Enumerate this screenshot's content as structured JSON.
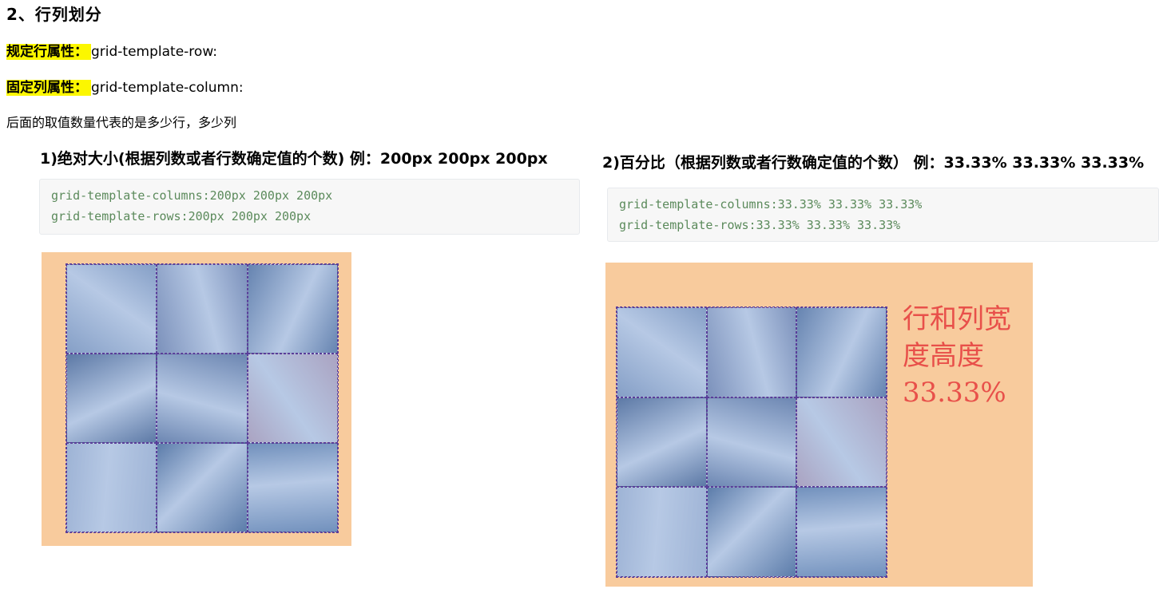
{
  "heading": "2、行列划分",
  "row_prop": {
    "label": "规定行属性：",
    "value": "grid-template-row:"
  },
  "col_prop": {
    "label": "固定列属性：",
    "value": "grid-template-column:"
  },
  "description": "后面的取值数量代表的是多少行，多少列",
  "example1": {
    "title": "1)绝对大小(根据列数或者行数确定值的个数) 例：200px 200px 200px",
    "code_line1": "grid-template-columns:200px 200px 200px",
    "code_line2": "grid-template-rows:200px 200px 200px"
  },
  "example2": {
    "title": "2)百分比（根据列数或者行数确定值的个数） 例：33.33% 33.33% 33.33%",
    "code_line1": "grid-template-columns:33.33% 33.33% 33.33%",
    "code_line2": "grid-template-rows:33.33% 33.33% 33.33%",
    "annotation_line1": "行和列宽",
    "annotation_line2": "度高度",
    "annotation_line3": "33.33%"
  },
  "cell_colors": [
    "#7d94b8",
    "#6f7fa7",
    "#4d6a96",
    "#3f5a86",
    "#586f99",
    "#b69ab0",
    "#a3b3cf",
    "#3d5e8c",
    "#5f7ea9"
  ]
}
